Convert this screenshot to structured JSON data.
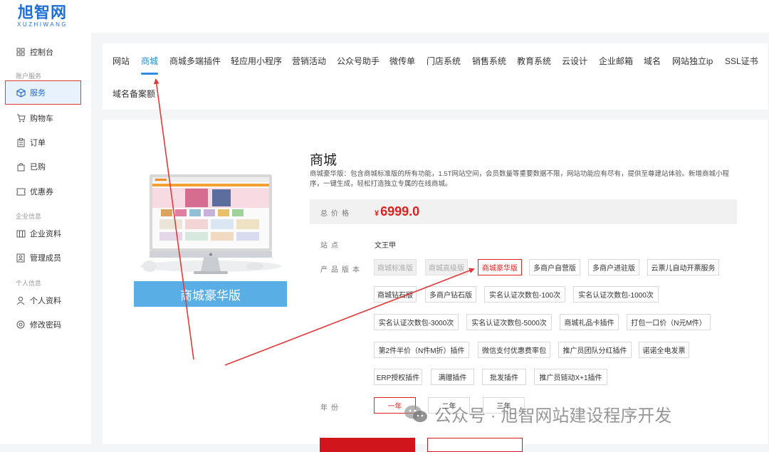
{
  "logo": {
    "cn": "旭智网",
    "en": "XUZHIWANG"
  },
  "sidebar": {
    "dashboard": "控制台",
    "group_account": "账户服务",
    "services": "服务",
    "cart": "购物车",
    "orders": "订单",
    "purchased": "已购",
    "coupons": "优惠券",
    "group_enterprise": "企业信息",
    "company_info": "企业资料",
    "members": "管理成员",
    "group_personal": "个人信息",
    "profile": "个人资料",
    "password": "修改密码"
  },
  "tabs": [
    "网站",
    "商城",
    "商城多端插件",
    "轻应用小程序",
    "营销活动",
    "公众号助手",
    "微传单",
    "门店系统",
    "销售系统",
    "教育系统",
    "云设计",
    "企业邮箱",
    "域名",
    "网站独立ip",
    "SSL证书",
    "域名备案额"
  ],
  "product": {
    "banner": "商城豪华版",
    "title": "商城",
    "desc": "商城豪华版：包含商城标准版的所有功能，1.5T网站空间，会员数量等重要数据不限，网站功能应有尽有，提供至尊建站体验。新增商城小程序，一键生成，轻松打造独立专属的在线商城。",
    "price_label": "总价格",
    "currency": "¥",
    "price": "6999.0",
    "site_label": "站点",
    "site_value": "文王甲",
    "version_label": "产品版本",
    "year_label": "年份"
  },
  "versions": [
    {
      "label": "商城标准版",
      "state": "disabled"
    },
    {
      "label": "商城高级版",
      "state": "disabled"
    },
    {
      "label": "商城豪华版",
      "state": "selected"
    },
    {
      "label": "多商户自营版",
      "state": "normal"
    },
    {
      "label": "多商户进驻版",
      "state": "normal"
    },
    {
      "label": "云票儿自动开票服务",
      "state": "normal"
    },
    {
      "label": "商城钻石版",
      "state": "normal"
    },
    {
      "label": "多商户钻石版",
      "state": "normal"
    },
    {
      "label": "实名认证次数包-100次",
      "state": "normal"
    },
    {
      "label": "实名认证次数包-1000次",
      "state": "normal"
    },
    {
      "label": "实名认证次数包-3000次",
      "state": "normal"
    },
    {
      "label": "实名认证次数包-5000次",
      "state": "normal"
    },
    {
      "label": "商城礼品卡插件",
      "state": "normal"
    },
    {
      "label": "打包一口价（N元M件）",
      "state": "normal"
    },
    {
      "label": "第2件半价（N件M折）插件",
      "state": "normal"
    },
    {
      "label": "微信支付优惠费率包",
      "state": "normal"
    },
    {
      "label": "推广员团队分红插件",
      "state": "normal"
    },
    {
      "label": "诺诺全电发票",
      "state": "normal"
    },
    {
      "label": "ERP授权插件",
      "state": "normal"
    },
    {
      "label": "满赠插件",
      "state": "normal"
    },
    {
      "label": "批发插件",
      "state": "normal"
    },
    {
      "label": "推广员链动X+1插件",
      "state": "normal"
    }
  ],
  "years": [
    {
      "label": "一年",
      "state": "selected"
    },
    {
      "label": "二年",
      "state": "normal"
    },
    {
      "label": "三年",
      "state": "normal"
    }
  ],
  "watermark": "公众号 · 旭智网站建设程序开发",
  "colors": {
    "brand": "#1f6fd6",
    "tab_active": "#1f8bd6",
    "price": "#e02020",
    "annotation": "#e23a3a"
  }
}
